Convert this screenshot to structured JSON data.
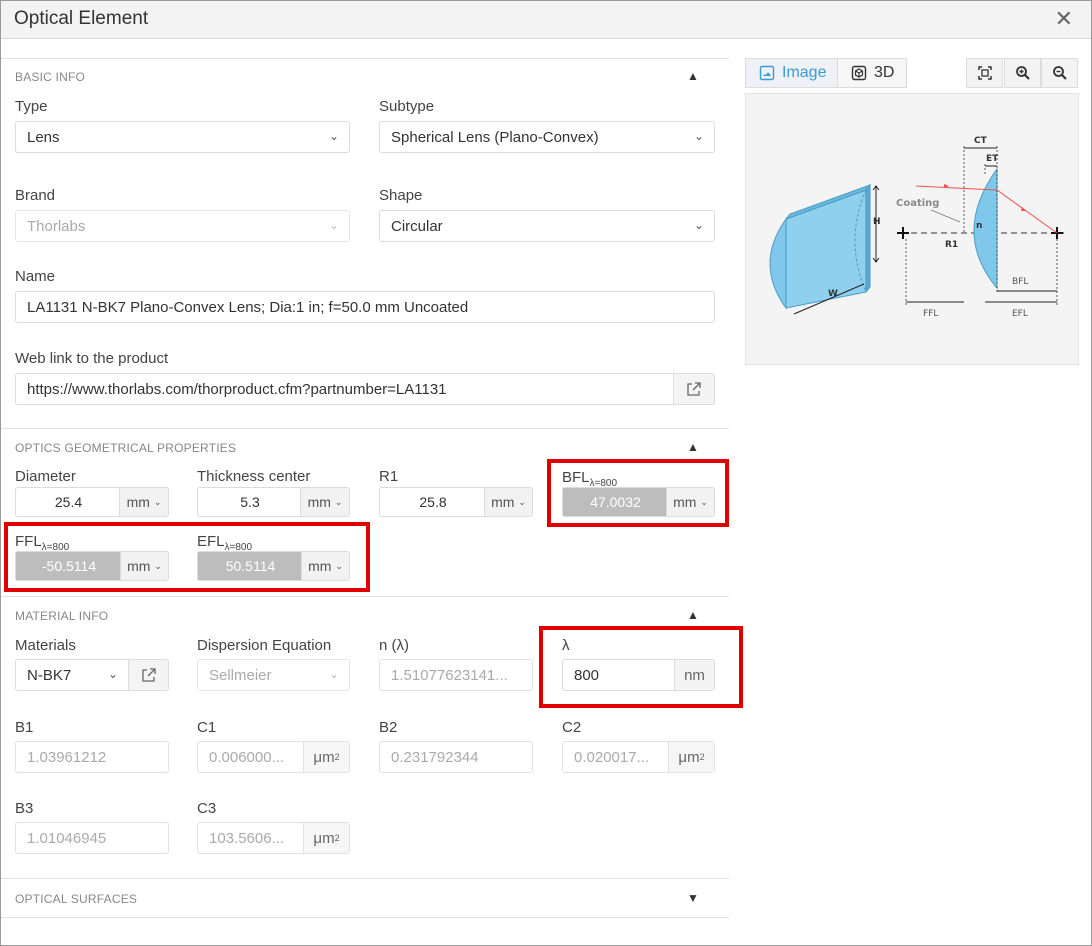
{
  "dialog": {
    "title": "Optical Element",
    "close_icon": "close-icon"
  },
  "basic_info": {
    "section_title": "BASIC INFO",
    "type": {
      "label": "Type",
      "value": "Lens"
    },
    "subtype": {
      "label": "Subtype",
      "value": "Spherical Lens (Plano-Convex)"
    },
    "brand": {
      "label": "Brand",
      "value": "Thorlabs"
    },
    "shape": {
      "label": "Shape",
      "value": "Circular"
    },
    "name": {
      "label": "Name",
      "value": "LA1131 N-BK7 Plano-Convex Lens; Dia:1 in; f=50.0 mm Uncoated"
    },
    "web_link": {
      "label": "Web link to the product",
      "value": "https://www.thorlabs.com/thorproduct.cfm?partnumber=LA1131"
    }
  },
  "optics": {
    "section_title": "OPTICS GEOMETRICAL PROPERTIES",
    "diameter": {
      "label": "Diameter",
      "value": "25.4",
      "unit": "mm"
    },
    "thickness": {
      "label": "Thickness center",
      "value": "5.3",
      "unit": "mm"
    },
    "r1": {
      "label": "R1",
      "value": "25.8",
      "unit": "mm"
    },
    "bfl": {
      "label": "BFL",
      "sub": "λ=800",
      "value": "47.0032",
      "unit": "mm"
    },
    "ffl": {
      "label": "FFL",
      "sub": "λ=800",
      "value": "-50.5114",
      "unit": "mm"
    },
    "efl": {
      "label": "EFL",
      "sub": "λ=800",
      "value": "50.5114",
      "unit": "mm"
    }
  },
  "material": {
    "section_title": "MATERIAL INFO",
    "materials": {
      "label": "Materials",
      "value": "N-BK7"
    },
    "dispersion": {
      "label": "Dispersion Equation",
      "value": "Sellmeier"
    },
    "n": {
      "label": "n (λ)",
      "value": "1.51077623141..."
    },
    "lambda": {
      "label": "λ",
      "value": "800",
      "unit": "nm"
    },
    "b1": {
      "label": "B1",
      "value": "1.03961212"
    },
    "c1": {
      "label": "C1",
      "value": "0.006000...",
      "unit": "μm",
      "unit_exp": "2"
    },
    "b2": {
      "label": "B2",
      "value": "0.231792344"
    },
    "c2": {
      "label": "C2",
      "value": "0.020017...",
      "unit": "μm",
      "unit_exp": "2"
    },
    "b3": {
      "label": "B3",
      "value": "1.01046945"
    },
    "c3": {
      "label": "C3",
      "value": "103.5606...",
      "unit": "μm",
      "unit_exp": "2"
    }
  },
  "optical_surfaces": {
    "section_title": "OPTICAL SURFACES"
  },
  "viewer": {
    "tab_image": "Image",
    "tab_3d": "3D",
    "diagram_labels": {
      "ct": "CT",
      "et": "ET",
      "h": "H",
      "w": "W",
      "coating": "Coating",
      "n": "n",
      "r1": "R1",
      "bfl": "BFL",
      "ffl": "FFL",
      "efl": "EFL"
    }
  },
  "colors": {
    "accent": "#3a9bd6",
    "highlight": "#e00000",
    "lens": "#7fc8ec",
    "ray": "#f05050"
  }
}
